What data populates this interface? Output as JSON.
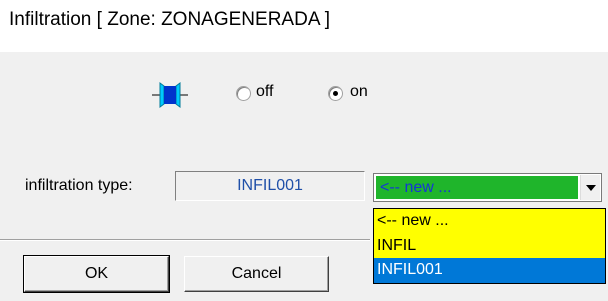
{
  "window": {
    "title": "Infiltration [ Zone: ZONAGENERADA ]"
  },
  "state_icon": {
    "name": "window-icon",
    "colors": {
      "frame": "#00c8ff",
      "glass": "#0033cc"
    }
  },
  "state": {
    "options": [
      {
        "label": "off",
        "selected": false
      },
      {
        "label": "on",
        "selected": true
      }
    ]
  },
  "infiltration": {
    "label": "infiltration type:",
    "value": "INFIL001",
    "select_value": "<-- new ...",
    "options": [
      {
        "label": "<-- new ...",
        "highlight": "yellow"
      },
      {
        "label": "INFIL",
        "highlight": "yellow"
      },
      {
        "label": "INFIL001",
        "highlight": "selected"
      }
    ]
  },
  "buttons": {
    "ok": "OK",
    "cancel": "Cancel"
  },
  "colors": {
    "panel_bg": "#f0f0f0",
    "select_bg": "#1fb52b",
    "select_text": "#1536d6",
    "list_yellow": "#ffff00",
    "list_selected": "#0078d7",
    "field_text": "#1f4fa8"
  }
}
